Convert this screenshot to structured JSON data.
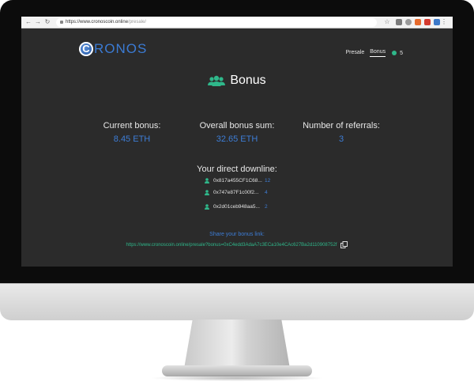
{
  "browser": {
    "url_host": "https://www.cronoscoin.online",
    "url_path": "/presale/"
  },
  "site": {
    "logo_letter": "C",
    "logo_text": "RONOS",
    "nav": [
      {
        "label": "Presale"
      },
      {
        "label": "Bonus"
      }
    ],
    "coin_count": "5"
  },
  "page": {
    "title": "Bonus"
  },
  "stats": [
    {
      "label": "Current bonus:",
      "value": "8.45 ETH"
    },
    {
      "label": "Overall bonus sum:",
      "value": "32.65 ETH"
    },
    {
      "label": "Number of referrals:",
      "value": "3"
    }
  ],
  "downline": {
    "title": "Your direct downline:",
    "rows": [
      {
        "address": "0x817a455CF1C68...",
        "count": "12"
      },
      {
        "address": "0x747e87F1c00f2...",
        "count": "4"
      },
      {
        "address": "0x2d01ceb948aa5...",
        "count": "2"
      }
    ]
  },
  "share": {
    "label": "Share your bonus link:",
    "url": "https://www.cronoscoin.online/presale?bonus=0xC4edd3AdaA7c3ECa10e4CAc627Ba2d110908752f"
  },
  "colors": {
    "accent_blue": "#3d7dd6",
    "accent_green": "#2fb78a",
    "background": "#2b2b2b"
  }
}
